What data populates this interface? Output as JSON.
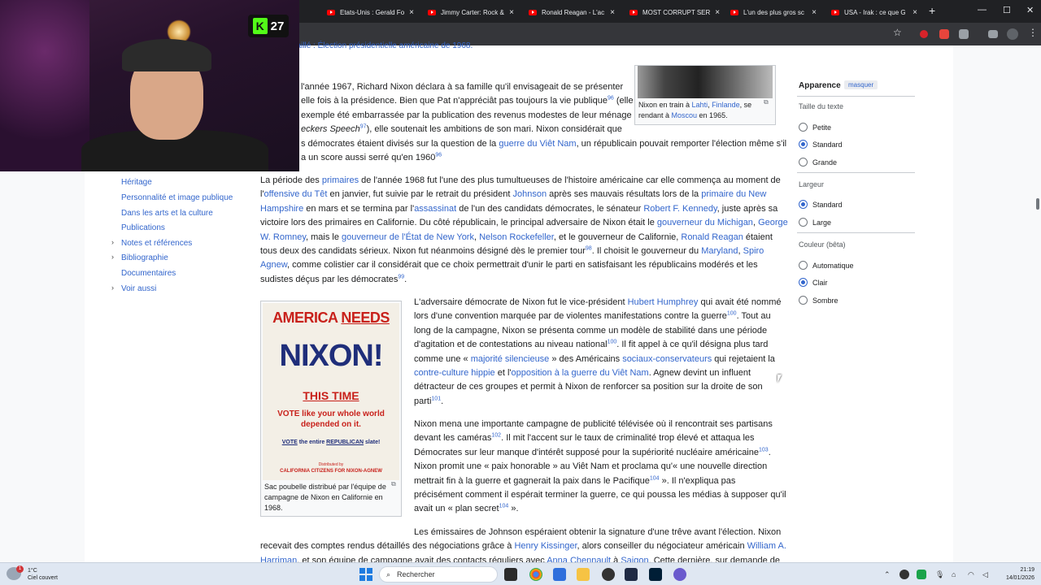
{
  "browser": {
    "tabs": [
      {
        "title": "Etats-Unis : Gerald Fo"
      },
      {
        "title": "Jimmy Carter: Rock &"
      },
      {
        "title": "Ronald Reagan - L'ac"
      },
      {
        "title": "MOST CORRUPT SER"
      },
      {
        "title": "L'un des plus gros sc"
      },
      {
        "title": "USA - Irak : ce que G"
      }
    ],
    "new_tab": "+",
    "close_glyph": "×",
    "minimize": "—",
    "maximize": "☐",
    "close_window": "✕"
  },
  "webcam": {
    "badge_letter": "K",
    "badge_count": "27"
  },
  "toc": {
    "items": [
      {
        "label": "Héritage"
      },
      {
        "label": "Personnalité et image publique"
      },
      {
        "label": "Dans les arts et la culture"
      },
      {
        "label": "Publications"
      },
      {
        "label": "Notes et références"
      },
      {
        "label": "Bibliographie"
      },
      {
        "label": "Documentaires"
      },
      {
        "label": "Voir aussi"
      }
    ]
  },
  "article": {
    "top_cut": "Article détaillé : Élection présidentielle américaine de 1968.",
    "p1": {
      "lines": [
        "l'année 1967, Richard Nixon déclara à sa famille qu'il envisageait de se présenter",
        "elle fois à la présidence. Bien que Pat n'appréciât pas toujours la vie publique",
        "exemple été embarrassée par la publication des revenus modestes de leur ménage",
        "eckers Speech",
        "), elle soutenait les ambitions de son mari. Nixon considérait que",
        "s démocrates étaient divisés sur la question de la",
        "guerre du Viêt Nam",
        ", un républicain pouvait remporter l'élection même s'il",
        "a un score aussi serré qu'en 1960"
      ],
      "ref96a": "96",
      "ref97": "97",
      "ref96b": "96",
      "elle": "(elle"
    },
    "p2": {
      "l1a": "La période des ",
      "l1b": "primaires",
      "l1c": " de l'année 1968 fut l'une des plus tumultueuses de l'histoire américaine car elle commença au moment de",
      "l2a": "l'",
      "l2b": "offensive du Têt",
      "l2c": " en janvier, fut suivie par le retrait du président ",
      "l2d": "Johnson",
      "l2e": " après ses mauvais résultats lors de la ",
      "l2f": "primaire du New",
      "l3a": "Hampshire",
      "l3b": " en mars et se termina par l'",
      "l3c": "assassinat",
      "l3d": " de l'un des candidats démocrates, le sénateur ",
      "l3e": "Robert F. Kennedy",
      "l3f": ", juste après sa",
      "l4a": "victoire lors des primaires en Californie. Du côté républicain, le principal adversaire de Nixon était le ",
      "l4b": "gouverneur du Michigan",
      "l4c": ", ",
      "l4d": "George",
      "l5a": "W. Romney",
      "l5b": ", mais le ",
      "l5c": "gouverneur de l'État de New York",
      "l5d": ", ",
      "l5e": "Nelson Rockefeller",
      "l5f": ", et le gouverneur de Californie, ",
      "l5g": "Ronald Reagan",
      "l5h": " étaient",
      "l6a": "tous deux des candidats sérieux. Nixon fut néanmoins désigné dès le premier tour",
      "ref98": "98",
      "l6b": ". Il choisit le gouverneur du ",
      "l6c": "Maryland",
      "l6d": ", ",
      "l6e": "Spiro",
      "l7a": "Agnew",
      "l7b": ", comme colistier car il considérait que ce choix permettrait d'unir le parti en satisfaisant les républicains modérés et les",
      "l8a": "sudistes déçus par les démocrates",
      "ref99": "99",
      "l8b": "."
    },
    "p3": {
      "l1a": "L'adversaire démocrate de Nixon fut le vice-président ",
      "l1b": "Hubert Humphrey",
      "l1c": " qui avait été nommé",
      "l2a": "lors d'une convention marquée par de violentes manifestations contre la guerre",
      "ref100a": "100",
      "l2b": ". Tout au",
      "l3": "long de la campagne, Nixon se présenta comme un modèle de stabilité dans une période",
      "l4a": "d'agitation et de contestations au niveau national",
      "ref100b": "100",
      "l4b": ". Il fit appel à ce qu'il désigna plus tard",
      "l5a": "comme une « ",
      "l5b": "majorité silencieuse",
      "l5c": " » des Américains ",
      "l5d": "sociaux-conservateurs",
      "l5e": " qui rejetaient la",
      "l6a": "contre-culture hippie",
      "l6b": " et l'",
      "l6c": "opposition à la guerre du Viêt Nam",
      "l6d": ". Agnew devint un influent",
      "l7": "détracteur de ces groupes et permit à Nixon de renforcer sa position sur la droite de son",
      "l8a": "parti",
      "ref101": "101",
      "l8b": "."
    },
    "p4": {
      "l1": "Nixon mena une importante campagne de publicité télévisée où il rencontrait ses partisans",
      "l2a": "devant les caméras",
      "ref102": "102",
      "l2b": ". Il mit l'accent sur le taux de criminalité trop élevé et attaqua les",
      "l3a": "Démocrates sur leur manque d'intérêt supposé pour la supériorité nucléaire américaine",
      "ref103": "103",
      "l3b": ".",
      "l4": "Nixon promit une « paix honorable » au Viêt Nam et proclama qu'« une nouvelle direction",
      "l5a": "mettrait fin à la guerre et gagnerait la paix dans le Pacifique",
      "ref104a": "104",
      "l5b": " ». Il n'expliqua pas",
      "l6": "précisément comment il espérait terminer la guerre, ce qui poussa les médias à supposer qu'il",
      "l7a": "avait un « plan secret",
      "ref104b": "104",
      "l7b": " »."
    },
    "p5": {
      "l1": "Les émissaires de Johnson espéraient obtenir la signature d'une trêve avant l'élection. Nixon",
      "l2a": "recevait des comptes rendus détaillés des négociations grâce à ",
      "l2b": "Henry Kissinger",
      "l2c": ", alors conseiller du négociateur américain ",
      "l2d": "William A.",
      "l3a": "Harriman",
      "l3b": ", et son équipe de campagne avait des contacts réguliers avec ",
      "l3c": "Anna Chennault",
      "l3d": " à ",
      "l3e": "Saigon",
      "l3f": ". Cette dernière, sur demande de"
    },
    "fig_top": {
      "cap_a": "Nixon en train à ",
      "cap_b": "Lahti",
      "cap_c": ", ",
      "cap_d": "Finlande",
      "cap_e": ", se rendant à ",
      "cap_f": "Moscou",
      "cap_g": " en 1965."
    },
    "fig_poster": {
      "line1a": "AMERICA ",
      "line1b": "NEEDS",
      "line2": "NIXON!",
      "line3": "THIS TIME",
      "line4": "VOTE like your whole world depended on it.",
      "line5a": "VOTE",
      "line5b": " the entire ",
      "line5c": "REPUBLICAN",
      "line5d": " slate!",
      "line6": "Distributed by",
      "line7": "CALIFORNIA CITIZENS FOR NIXON-AGNEW",
      "caption": "Sac poubelle distribué par l'équipe de campagne de Nixon en Californie en 1968."
    }
  },
  "panel": {
    "title": "Apparence",
    "hide": "masquer",
    "text_size_label": "Taille du texte",
    "text_size_options": [
      {
        "label": "Petite",
        "selected": false
      },
      {
        "label": "Standard",
        "selected": true
      },
      {
        "label": "Grande",
        "selected": false
      }
    ],
    "width_label": "Largeur",
    "width_options": [
      {
        "label": "Standard",
        "selected": true
      },
      {
        "label": "Large",
        "selected": false
      }
    ],
    "color_label": "Couleur (bêta)",
    "color_options": [
      {
        "label": "Automatique",
        "selected": false
      },
      {
        "label": "Clair",
        "selected": true
      },
      {
        "label": "Sombre",
        "selected": false
      }
    ]
  },
  "taskbar": {
    "temperature": "1°C",
    "weather_desc": "Ciel couvert",
    "weather_badge": "1",
    "search_placeholder": "Rechercher",
    "time": "21:19",
    "date": "14/01/2026"
  },
  "colors": {
    "link": "#3366cc",
    "text": "#202122",
    "chrome_dark": "#202124",
    "youtube": "#ff0000"
  }
}
